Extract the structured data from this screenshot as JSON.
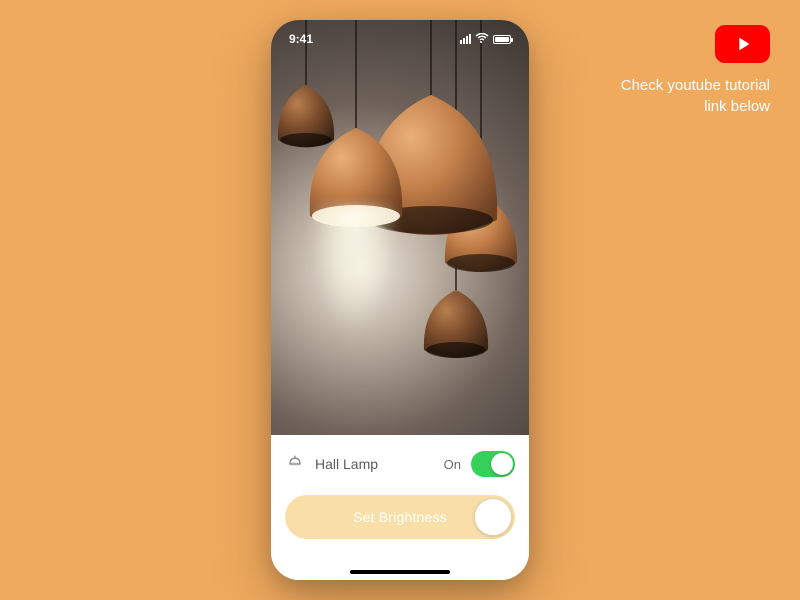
{
  "canvas": {
    "background": "#f0aa5e"
  },
  "callout": {
    "icon_name": "youtube-icon",
    "line1": "Check youtube tutorial",
    "line2": "link below"
  },
  "status_bar": {
    "time": "9:41"
  },
  "device": {
    "name": "Hall Lamp",
    "state_label": "On",
    "toggle_on": true
  },
  "brightness": {
    "button_label": "Set Brightness"
  },
  "colors": {
    "toggle_on": "#35d15a",
    "brightness_bg": "#f9dfa7",
    "youtube_red": "#ff0000"
  }
}
